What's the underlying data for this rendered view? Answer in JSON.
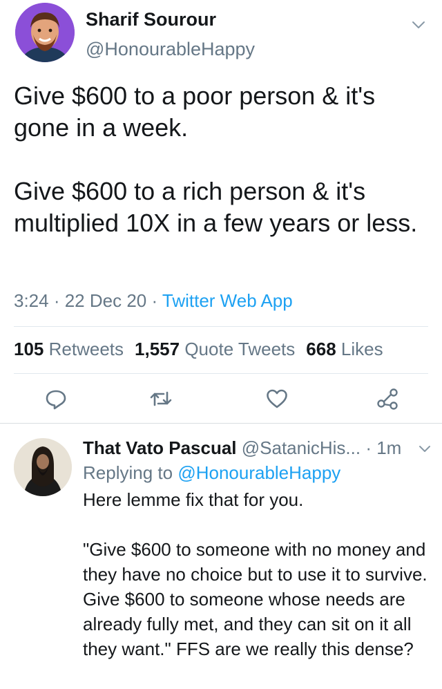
{
  "tweet": {
    "author_name": "Sharif Sourour",
    "author_handle": "@HonourableHappy",
    "avatar_icon": "profile-photo-avatar",
    "avatar_bg": "#8b4fd8",
    "text": "Give $600 to a poor person & it's gone in a week.\n\nGive $600 to a rich person & it's multiplied 10X in a few years or less.",
    "time": "3:24",
    "date": "22 Dec 20",
    "source": "Twitter Web App",
    "separator": " · ",
    "stats": {
      "retweets_count": "105",
      "retweets_label": "Retweets",
      "quote_count": "1,557",
      "quote_label": "Quote Tweets",
      "likes_count": "668",
      "likes_label": "Likes"
    },
    "actions": [
      "reply-icon",
      "retweet-icon",
      "like-icon",
      "share-icon"
    ]
  },
  "reply": {
    "author_name": "That Vato Pascual",
    "author_handle": "@SatanicHis...",
    "time_separator": " · ",
    "time": "1m",
    "replying_prefix": "Replying to ",
    "replying_mention": "@HonourableHappy",
    "avatar_icon": "profile-photo-avatar",
    "text": "Here lemme fix that for you.\n\n\"Give $600 to someone with no money and they have no choice but to use it to survive. Give $600 to someone whose needs are already fully met, and they can sit on it all they want.\" FFS are we really this dense?"
  },
  "colors": {
    "text": "#14171a",
    "secondary": "#657786",
    "link": "#1da1f2",
    "divider": "#e1e8ed"
  }
}
